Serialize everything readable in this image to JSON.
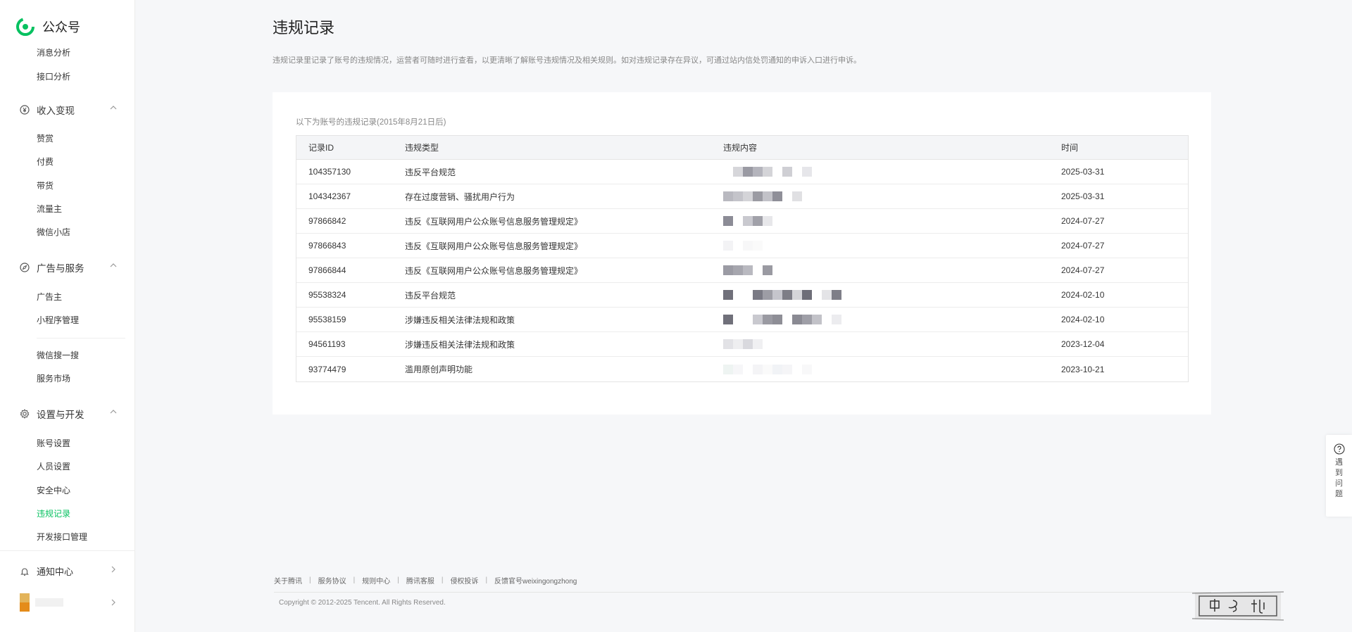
{
  "brand": {
    "name": "公众号"
  },
  "sidebar": {
    "top_items": [
      {
        "label": "消息分析"
      },
      {
        "label": "接口分析"
      }
    ],
    "groups": [
      {
        "label": "收入变现",
        "icon": "yen-icon",
        "items": [
          {
            "label": "赞赏"
          },
          {
            "label": "付费"
          },
          {
            "label": "带货"
          },
          {
            "label": "流量主"
          },
          {
            "label": "微信小店"
          }
        ]
      },
      {
        "label": "广告与服务",
        "icon": "compass-icon",
        "items": [
          {
            "label": "广告主"
          },
          {
            "label": "小程序管理"
          },
          {
            "label": "微信搜一搜"
          },
          {
            "label": "服务市场"
          }
        ]
      },
      {
        "label": "设置与开发",
        "icon": "gear-icon",
        "items": [
          {
            "label": "账号设置"
          },
          {
            "label": "人员设置"
          },
          {
            "label": "安全中心"
          },
          {
            "label": "违规记录"
          },
          {
            "label": "开发接口管理"
          }
        ]
      }
    ],
    "notify": {
      "label": "通知中心"
    },
    "active_item": "违规记录"
  },
  "main": {
    "title": "违规记录",
    "description": "违规记录里记录了账号的违规情况，运营者可随时进行查看，以更清晰了解账号违规情况及相关规则。如对违规记录存在异议，可通过站内信处罚通知的申诉入口进行申诉。",
    "caption": "以下为账号的违规记录(2015年8月21日后)",
    "table": {
      "headers": [
        "记录ID",
        "违规类型",
        "违规内容",
        "时间"
      ],
      "rows": [
        {
          "id": "104357130",
          "type": "违反平台规范",
          "time": "2025-03-31"
        },
        {
          "id": "104342367",
          "type": "存在过度营销、骚扰用户行为",
          "time": "2025-03-31"
        },
        {
          "id": "97866842",
          "type": "违反《互联网用户公众账号信息服务管理规定》",
          "time": "2024-07-27"
        },
        {
          "id": "97866843",
          "type": "违反《互联网用户公众账号信息服务管理规定》",
          "time": "2024-07-27"
        },
        {
          "id": "97866844",
          "type": "违反《互联网用户公众账号信息服务管理规定》",
          "time": "2024-07-27"
        },
        {
          "id": "95538324",
          "type": "违反平台规范",
          "time": "2024-02-10"
        },
        {
          "id": "95538159",
          "type": "涉嫌违反相关法律法规和政策",
          "time": "2024-02-10"
        },
        {
          "id": "94561193",
          "type": "涉嫌违反相关法律法规和政策",
          "time": "2023-12-04"
        },
        {
          "id": "93774479",
          "type": "滥用原创声明功能",
          "time": "2023-10-21"
        }
      ]
    }
  },
  "footer": {
    "links": [
      "关于腾讯",
      "服务协议",
      "规则中心",
      "腾讯客服",
      "侵权投诉",
      "反馈官号weixingongzhong"
    ],
    "copyright": "Copyright © 2012-2025 Tencent. All Rights Reserved."
  },
  "help": {
    "label": "遇到问题"
  },
  "colors": {
    "accent": "#07c160",
    "background": "#f6f7f9"
  }
}
